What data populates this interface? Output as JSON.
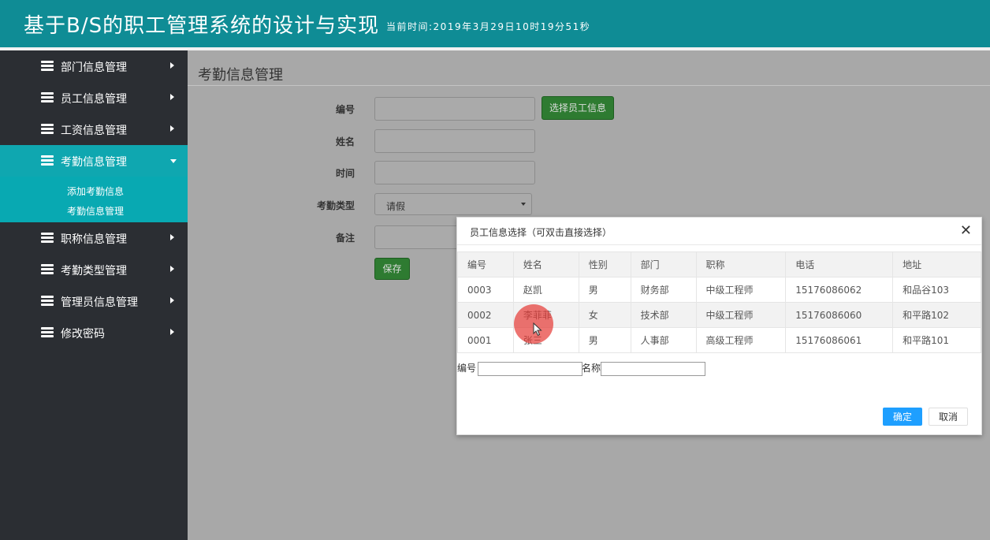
{
  "header": {
    "title": "基于B/S的职工管理系统的设计与实现",
    "current_time": "当前时间:2019年3月29日10时19分51秒"
  },
  "sidebar": {
    "items": [
      {
        "label": "部门信息管理",
        "icon": "stack-icon"
      },
      {
        "label": "员工信息管理",
        "icon": "stack-icon"
      },
      {
        "label": "工资信息管理",
        "icon": "stack-icon"
      },
      {
        "label": "考勤信息管理",
        "icon": "stack-icon",
        "expanded": true
      },
      {
        "label": "职称信息管理",
        "icon": "stack-icon"
      },
      {
        "label": "考勤类型管理",
        "icon": "stack-icon"
      },
      {
        "label": "管理员信息管理",
        "icon": "stack-icon"
      },
      {
        "label": "修改密码",
        "icon": "stack-icon"
      }
    ],
    "submenu": [
      "添加考勤信息",
      "考勤信息管理"
    ]
  },
  "main": {
    "page_title": "考勤信息管理",
    "form": {
      "id_label": "编号",
      "id_value": "",
      "select_employee_button": "选择员工信息",
      "name_label": "姓名",
      "name_value": "",
      "time_label": "时间",
      "time_value": "",
      "type_label": "考勤类型",
      "type_value": "请假",
      "remark_label": "备注",
      "remark_value": "",
      "save_button": "保存"
    }
  },
  "modal": {
    "title": "员工信息选择（可双击直接选择）",
    "columns": [
      "编号",
      "姓名",
      "性别",
      "部门",
      "职称",
      "电话",
      "地址"
    ],
    "rows": [
      [
        "0003",
        "赵凯",
        "男",
        "财务部",
        "中级工程师",
        "15176086062",
        "和品谷103"
      ],
      [
        "0002",
        "李菲菲",
        "女",
        "技术部",
        "中级工程师",
        "15176086060",
        "和平路102"
      ],
      [
        "0001",
        "张三",
        "男",
        "人事部",
        "高级工程师",
        "15176086061",
        "和平路101"
      ]
    ],
    "search_id_label": "编号",
    "search_id_value": "",
    "search_name_label": "名称",
    "search_name_value": "",
    "ok_button": "确定",
    "cancel_button": "取消"
  },
  "colors": {
    "header_bg": "#0f8c95",
    "sidebar_bg": "#2b2e33",
    "active_menu_bg": "#0fa7b0",
    "save_button_bg": "#2e7b31",
    "ok_button_bg": "#1e9fff"
  }
}
